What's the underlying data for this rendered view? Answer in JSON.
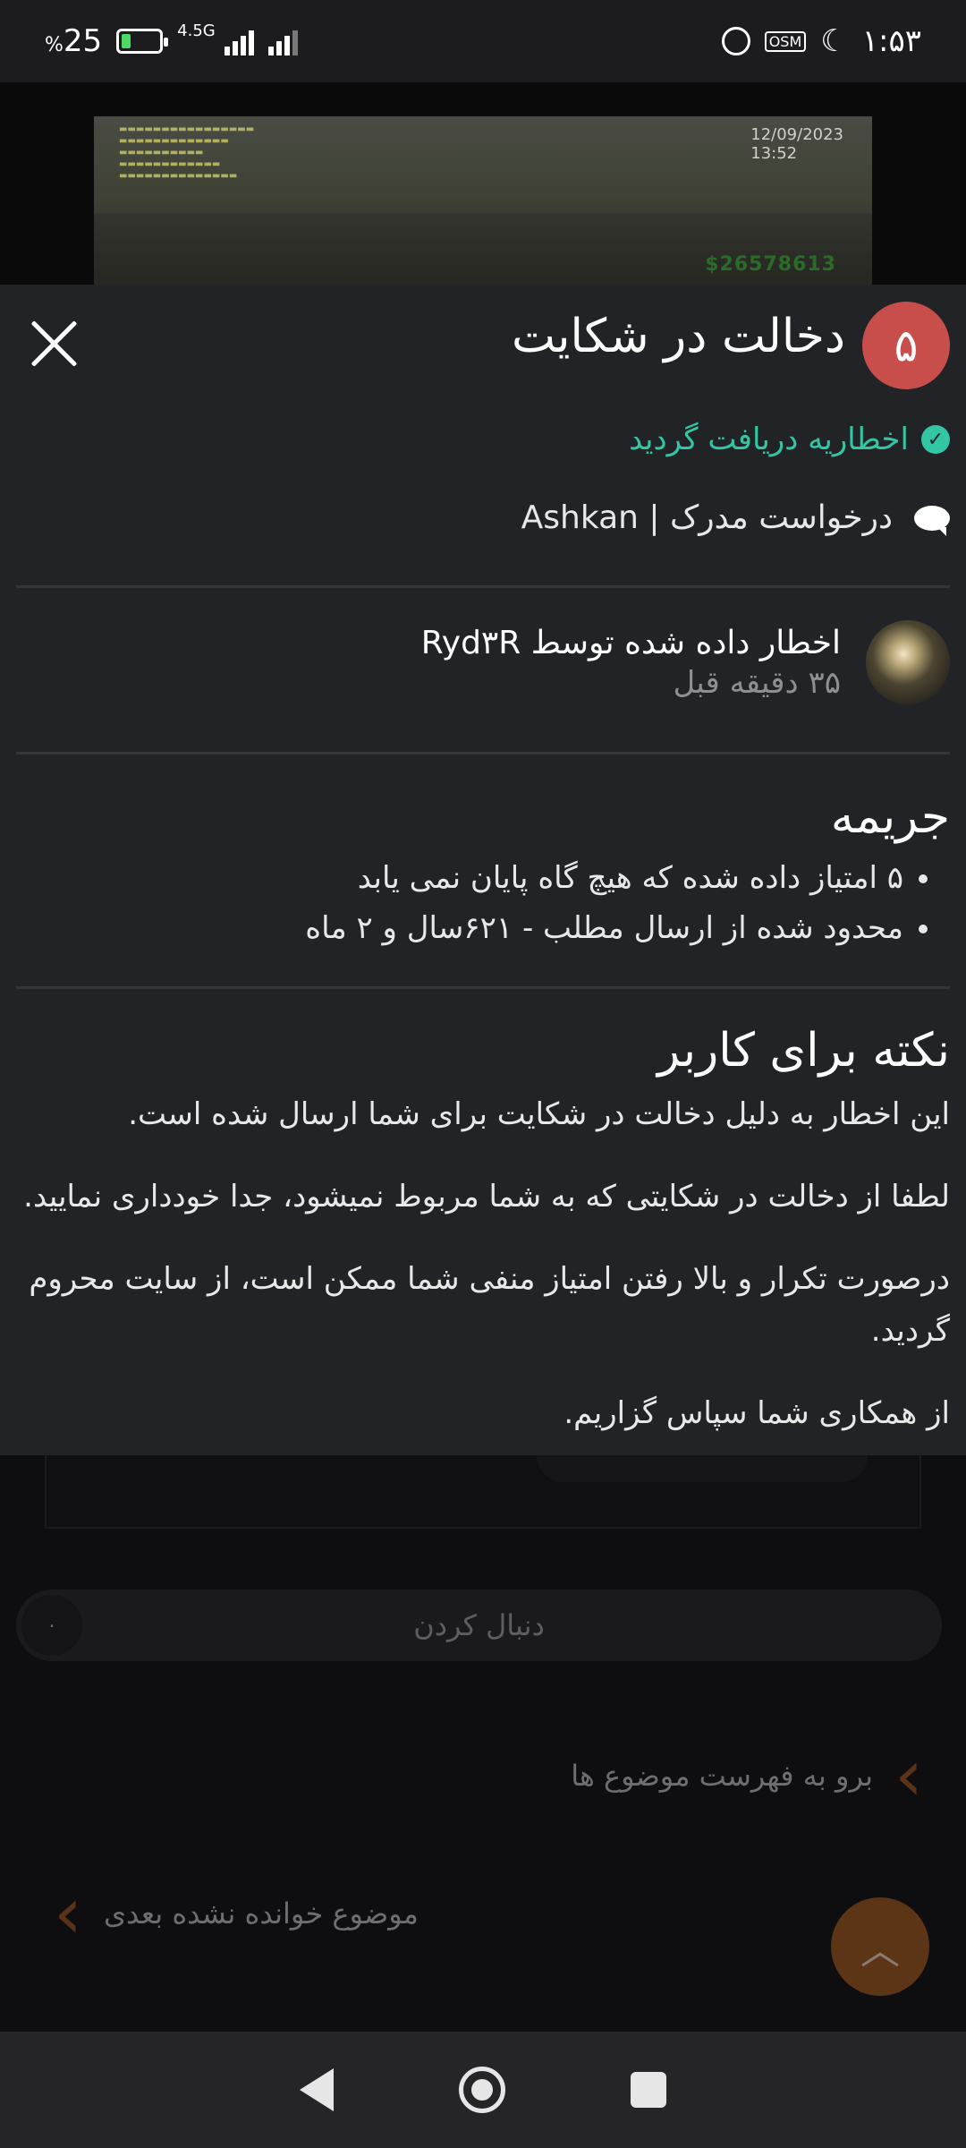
{
  "status_bar": {
    "battery_text": "25",
    "percent_sign": "%",
    "network_label": "4.5G",
    "osm_label": "OSM",
    "time": "۱:۵۳",
    "battery_level": 0.25
  },
  "background_image": {
    "hud_time": "12/09/2023\n13:52",
    "money": "$26578613"
  },
  "warning": {
    "points": "۵",
    "title": "دخالت در شکایت",
    "acknowledged_text": "اخطاریه دریافت گردید",
    "content_text": "درخواست مدرک | Ashkan",
    "issuer_text": "اخطار داده شده توسط Ryd۳R",
    "issued_time": "۳۵ دقیقه قبل",
    "penalty_title": "جریمه",
    "penalties": [
      "۵ امتیاز داده شده که هیچ گاه پایان نمی یابد",
      "محدود شده از ارسال مطلب - ۶۲۱سال و ۲ ماه"
    ],
    "note_title": "نکته برای کاربر",
    "note_paragraphs": [
      "این اخطار به دلیل دخالت در شکایت برای شما ارسال شده است.",
      "لطفا از دخالت در شکایتی که به شما مربوط نمیشود، جدا خودداری نمایید.",
      "درصورت تکرار و بالا رفتن امتیاز منفی شما ممکن است، از سایت محروم گردید.",
      "از همکاری شما سپاس گزاریم."
    ]
  },
  "underlying_page": {
    "follow_label": "دنبال کردن",
    "follow_count": "۰",
    "goto_list_label": "برو به فهرست موضوع ها",
    "next_unread_label": "موضوع خوانده نشده بعدی"
  },
  "colors": {
    "accent_green": "#33c6a4",
    "badge_red": "#c84e4c",
    "sheet_bg": "#222327"
  },
  "icons": [
    "close-icon",
    "check-circle-icon",
    "comment-icon",
    "chevron-right-icon",
    "chevron-left-icon",
    "chevron-up-icon",
    "back-icon",
    "home-icon",
    "recents-icon"
  ]
}
